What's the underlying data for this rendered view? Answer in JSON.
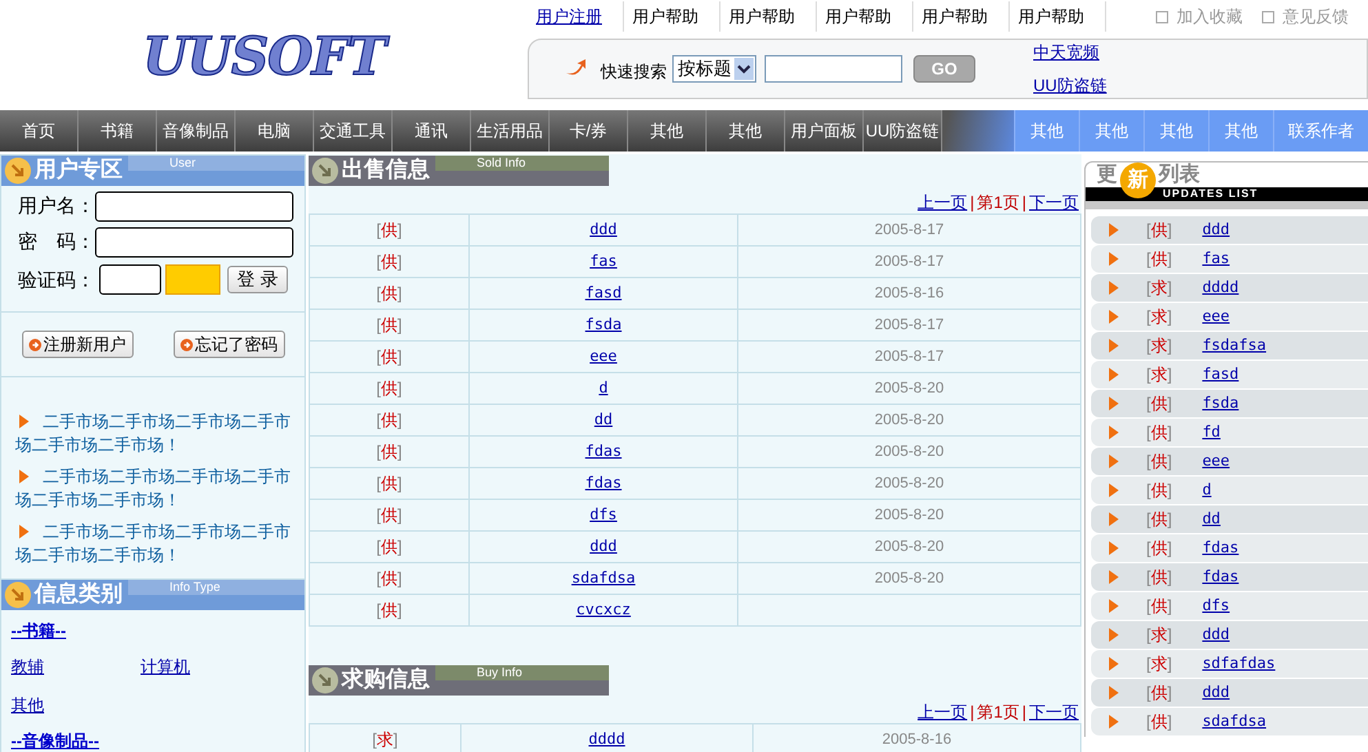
{
  "logo": "UUSOFT",
  "top_links": [
    {
      "label": "用户注册",
      "kind": "link"
    },
    {
      "label": "用户帮助",
      "kind": "plain"
    },
    {
      "label": "用户帮助",
      "kind": "plain"
    },
    {
      "label": "用户帮助",
      "kind": "plain"
    },
    {
      "label": "用户帮助",
      "kind": "plain"
    },
    {
      "label": "用户帮助",
      "kind": "plain"
    }
  ],
  "top_options": [
    {
      "label": "加入收藏",
      "checked": false
    },
    {
      "label": "意见反馈",
      "checked": false
    }
  ],
  "search": {
    "label": "快速搜索",
    "select": "按标题",
    "button": "GO",
    "links": [
      "中天宽频",
      "UU防盗链"
    ]
  },
  "nav": [
    {
      "label": "首页",
      "kind": "dark"
    },
    {
      "label": "书籍",
      "kind": "dark"
    },
    {
      "label": "音像制品",
      "kind": "dark"
    },
    {
      "label": "电脑",
      "kind": "dark"
    },
    {
      "label": "交通工具",
      "kind": "dark"
    },
    {
      "label": "通讯",
      "kind": "dark"
    },
    {
      "label": "生活用品",
      "kind": "dark"
    },
    {
      "label": "卡/券",
      "kind": "dark"
    },
    {
      "label": "其他",
      "kind": "dark"
    },
    {
      "label": "其他",
      "kind": "dark"
    },
    {
      "label": "用户面板",
      "kind": "dark"
    },
    {
      "label": "UU防盗链",
      "kind": "dark"
    },
    {
      "label": "其他",
      "kind": "blue"
    },
    {
      "label": "其他",
      "kind": "blue"
    },
    {
      "label": "其他",
      "kind": "blue"
    },
    {
      "label": "其他",
      "kind": "blue"
    },
    {
      "label": "联系作者",
      "kind": "blue"
    }
  ],
  "user_panel": {
    "title": "用户专区",
    "tag": "User",
    "username_label": "用户名：",
    "password_label": "密　码：",
    "captcha_label": "验证码：",
    "login": "登 录",
    "buttons": [
      "注册新用户",
      "忘记了密码"
    ],
    "notices": [
      "二手市场二手市场二手市场二手市场二手市场二手市场！",
      "二手市场二手市场二手市场二手市场二手市场二手市场！",
      "二手市场二手市场二手市场二手市场二手市场二手市场！"
    ]
  },
  "categories": {
    "title": "信息类别",
    "tag": "Info Type",
    "groups": [
      {
        "heading": "--书籍--",
        "items": [
          "教辅",
          "计算机",
          "其他"
        ]
      },
      {
        "heading": "--音像制品--"
      }
    ]
  },
  "sell": {
    "title": "出售信息",
    "tag": "Sold Info",
    "pager": {
      "prev": "上一页",
      "separators": [
        "|",
        "|"
      ],
      "current": "第1页",
      "next": "下一页"
    },
    "rows": [
      {
        "type": "[供]",
        "title": "ddd",
        "date": "2005-8-17"
      },
      {
        "type": "[供]",
        "title": "fas",
        "date": "2005-8-17"
      },
      {
        "type": "[供]",
        "title": "fasd",
        "date": "2005-8-16"
      },
      {
        "type": "[供]",
        "title": "fsda",
        "date": "2005-8-17"
      },
      {
        "type": "[供]",
        "title": "eee",
        "date": "2005-8-17"
      },
      {
        "type": "[供]",
        "title": "d",
        "date": "2005-8-20"
      },
      {
        "type": "[供]",
        "title": "dd",
        "date": "2005-8-20"
      },
      {
        "type": "[供]",
        "title": "fdas",
        "date": "2005-8-20"
      },
      {
        "type": "[供]",
        "title": "fdas",
        "date": "2005-8-20"
      },
      {
        "type": "[供]",
        "title": "dfs",
        "date": "2005-8-20"
      },
      {
        "type": "[供]",
        "title": "ddd",
        "date": "2005-8-20"
      },
      {
        "type": "[供]",
        "title": "sdafdsa",
        "date": "2005-8-20"
      },
      {
        "type": "[供]",
        "title": "cvcxcz"
      }
    ]
  },
  "buy": {
    "title": "求购信息",
    "tag": "Buy Info",
    "pager": {
      "prev": "上一页",
      "separators": [
        "|",
        "|"
      ],
      "current": "第1页",
      "next": "下一页"
    },
    "rows": [
      {
        "type": "[求]",
        "title": "dddd",
        "date": "2005-8-16"
      }
    ]
  },
  "updates": {
    "title_start": "更",
    "title_badge": "新",
    "title_end": "列表",
    "subtitle": "UPDATES LIST",
    "items": [
      {
        "type": "[供]",
        "title": "ddd"
      },
      {
        "type": "[供]",
        "title": "fas"
      },
      {
        "type": "[求]",
        "title": "dddd"
      },
      {
        "type": "[求]",
        "title": "eee"
      },
      {
        "type": "[求]",
        "title": "fsdafsa"
      },
      {
        "type": "[求]",
        "title": "fasd"
      },
      {
        "type": "[供]",
        "title": "fsda"
      },
      {
        "type": "[供]",
        "title": "fd"
      },
      {
        "type": "[供]",
        "title": "eee"
      },
      {
        "type": "[供]",
        "title": "d"
      },
      {
        "type": "[供]",
        "title": "dd"
      },
      {
        "type": "[供]",
        "title": "fdas"
      },
      {
        "type": "[供]",
        "title": "fdas"
      },
      {
        "type": "[供]",
        "title": "dfs"
      },
      {
        "type": "[求]",
        "title": "ddd"
      },
      {
        "type": "[求]",
        "title": "sdfafdas"
      },
      {
        "type": "[供]",
        "title": "ddd"
      },
      {
        "type": "[供]",
        "title": "sdafdsa"
      }
    ]
  }
}
